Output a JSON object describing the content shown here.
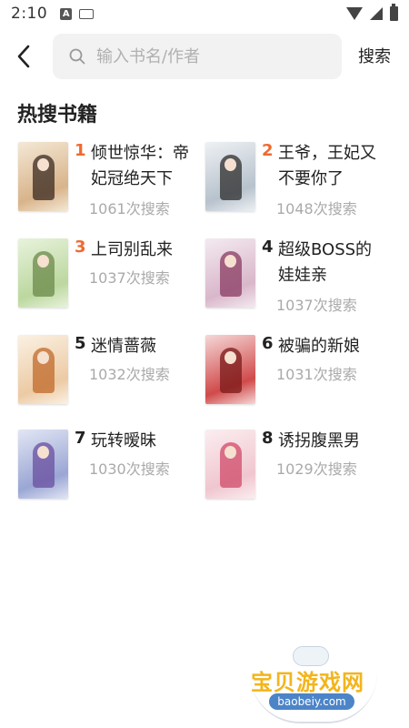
{
  "status_bar": {
    "time": "2:10",
    "a_badge": "A"
  },
  "header": {
    "search_placeholder": "输入书名/作者",
    "search_button": "搜索"
  },
  "section_title": "热搜书籍",
  "books": [
    {
      "rank": "1",
      "title": "倾世惊华：帝妃冠绝天下",
      "count": "1061次搜索",
      "cover_colors": [
        "#f4e8d6",
        "#d8b48a",
        "#3a2a20"
      ]
    },
    {
      "rank": "2",
      "title": "王爷，王妃又不要你了",
      "count": "1048次搜索",
      "cover_colors": [
        "#eef1f4",
        "#b7c2cc",
        "#2c2c2c"
      ]
    },
    {
      "rank": "3",
      "title": "上司别乱来",
      "count": "1037次搜索",
      "cover_colors": [
        "#e8f3dc",
        "#bcd79f",
        "#6b8a4a"
      ]
    },
    {
      "rank": "4",
      "title": "超级BOSS的娃娃亲",
      "count": "1037次搜索",
      "cover_colors": [
        "#f4eaf0",
        "#d9b7cb",
        "#8a3b62"
      ]
    },
    {
      "rank": "5",
      "title": "迷情蔷薇",
      "count": "1032次搜索",
      "cover_colors": [
        "#fbf1e3",
        "#eccaa4",
        "#c06a2a"
      ]
    },
    {
      "rank": "6",
      "title": "被骗的新娘",
      "count": "1031次搜索",
      "cover_colors": [
        "#f6d8d8",
        "#d04a4a",
        "#7a1a1a"
      ]
    },
    {
      "rank": "7",
      "title": "玩转暧昧",
      "count": "1030次搜索",
      "cover_colors": [
        "#e2e6f4",
        "#9aa6d4",
        "#6a4fa0"
      ]
    },
    {
      "rank": "8",
      "title": "诱拐腹黑男",
      "count": "1029次搜索",
      "cover_colors": [
        "#fbeef0",
        "#f0c6cf",
        "#d04a6a"
      ]
    }
  ],
  "rank_colors": {
    "top": "#ef6a2f",
    "normal": "#222222"
  },
  "watermark": {
    "main": "宝贝游戏网",
    "sub": "baobeiy.com"
  }
}
